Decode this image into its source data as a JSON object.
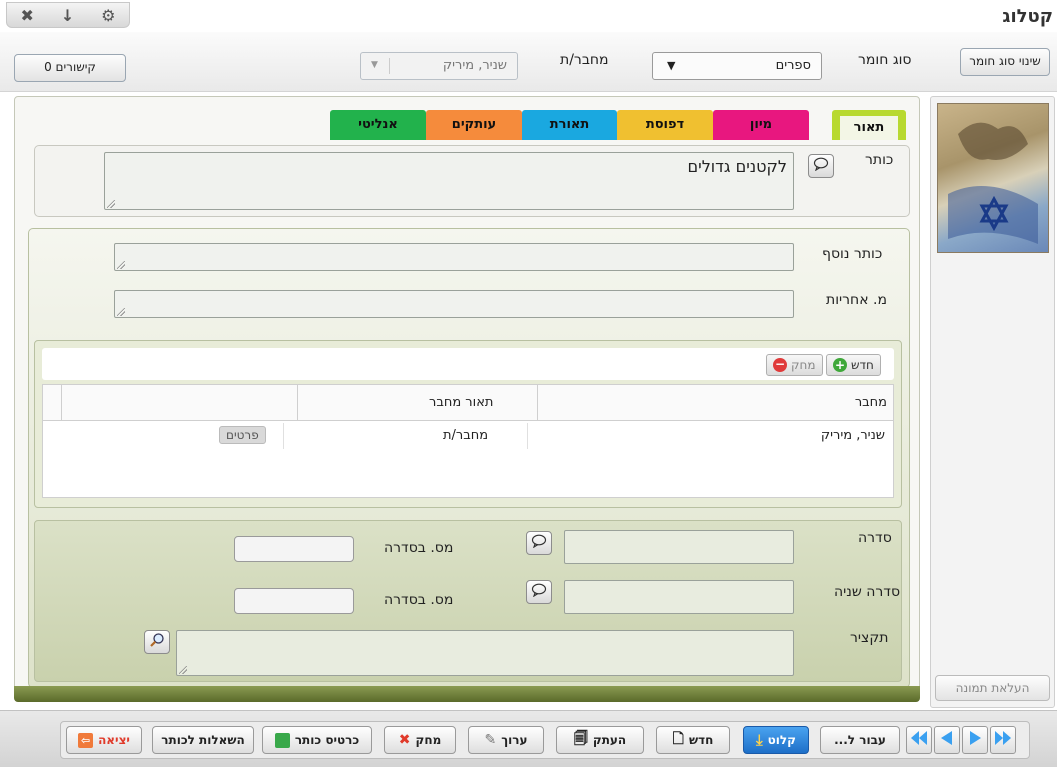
{
  "app": {
    "title": "קטלוג"
  },
  "window_controls": [
    "close-icon",
    "download-icon",
    "settings-icon"
  ],
  "topbar": {
    "change_material_button": "שינוי סוג חומר",
    "material_type_label": "סוג חומר",
    "material_type_value": "ספרים",
    "author_label": "מחבר/ת",
    "author_value": "שניר, מיריק",
    "links_button": "0 קישורים"
  },
  "tabs": [
    {
      "label": "תאור",
      "color": "#b8d92f"
    },
    {
      "label": "מיון",
      "color": "#e8177f"
    },
    {
      "label": "דפוסת",
      "color": "#f0c030"
    },
    {
      "label": "תאורת",
      "color": "#1aa8e0"
    },
    {
      "label": "עותקים",
      "color": "#f58b3c"
    },
    {
      "label": "אנליטי",
      "color": "#22b24c"
    }
  ],
  "title_section": {
    "label": "כותר",
    "value": "לקטנים גדולים"
  },
  "fields": {
    "subtitle_label": "כותר נוסף",
    "responsibility_label": "מ. אחריות"
  },
  "authors_table": {
    "new_button": "חדש",
    "delete_button": "מחק",
    "headers": [
      "מחבר",
      "תאור מחבר",
      ""
    ],
    "rows": [
      {
        "author": "שניר, מיריק",
        "role": "מחבר/ת",
        "details": "פרטים"
      }
    ]
  },
  "series_section": {
    "series_label": "סדרה",
    "series_number_label": "מס. בסדרה",
    "second_series_label": "סדרה שניה",
    "second_series_number_label": "מס. בסדרה",
    "summary_label": "תקציר"
  },
  "side": {
    "upload_image_button": "העלאת תמונה"
  },
  "bottom_toolbar": {
    "goto_button": "עבור ל...",
    "import_button": "קלוט",
    "new_button": "חדש",
    "copy_button": "העתק",
    "edit_button": "ערוך",
    "delete_button": "מחק",
    "card_button": "כרטיס כותר",
    "queries_button": "השאלות לכותר",
    "exit_button": "יציאה"
  },
  "colors": {
    "accent_blue": "#2f8fe0",
    "section_green": "#6a7a3a",
    "exit_red": "#e03a2a"
  }
}
